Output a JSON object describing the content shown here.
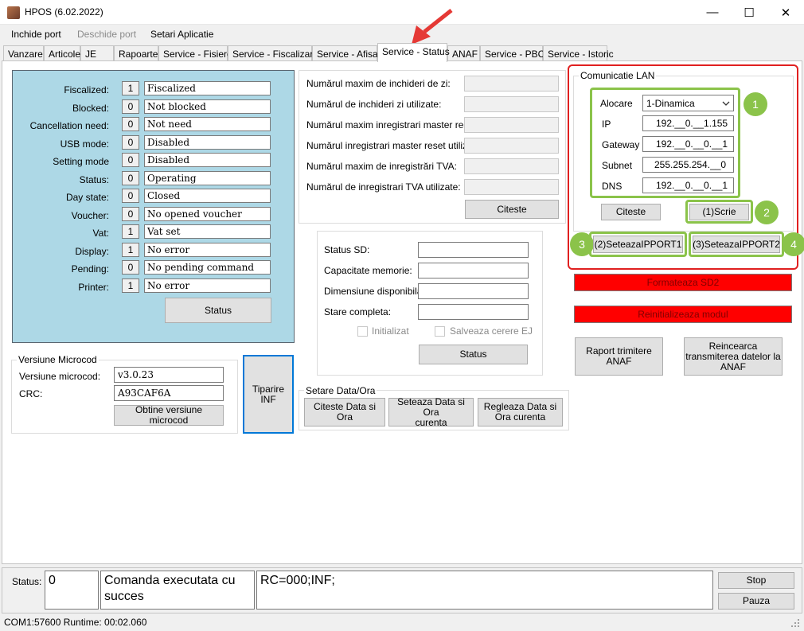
{
  "window": {
    "title": "HPOS (6.02.2022)",
    "minimize_glyph": "—",
    "maximize_glyph": "☐",
    "close_glyph": "✕"
  },
  "menu": {
    "items": [
      {
        "label": "Inchide port",
        "enabled": true
      },
      {
        "label": "Deschide port",
        "enabled": false
      },
      {
        "label": "Setari Aplicatie",
        "enabled": true
      }
    ]
  },
  "tabs": [
    {
      "label": "Vanzare"
    },
    {
      "label": "Articole"
    },
    {
      "label": "JE"
    },
    {
      "label": "Rapoarte"
    },
    {
      "label": "Service - Fisiere"
    },
    {
      "label": "Service - Fiscalizare"
    },
    {
      "label": "Service - Afisaj"
    },
    {
      "label": "Service - Status",
      "active": true
    },
    {
      "label": "ANAF"
    },
    {
      "label": "Service - PBC"
    },
    {
      "label": "Service - Istoric"
    }
  ],
  "status_panel": {
    "rows": [
      {
        "label": "Fiscalized:",
        "code": "1",
        "value": "Fiscalized"
      },
      {
        "label": "Blocked:",
        "code": "0",
        "value": "Not blocked"
      },
      {
        "label": "Cancellation need:",
        "code": "0",
        "value": "Not need"
      },
      {
        "label": "USB mode:",
        "code": "0",
        "value": "Disabled"
      },
      {
        "label": "Setting mode",
        "code": "0",
        "value": "Disabled"
      },
      {
        "label": "Status:",
        "code": "0",
        "value": "Operating"
      },
      {
        "label": "Day state:",
        "code": "0",
        "value": "Closed"
      },
      {
        "label": "Voucher:",
        "code": "0",
        "value": "No opened voucher"
      },
      {
        "label": "Vat:",
        "code": "1",
        "value": "Vat set"
      },
      {
        "label": "Display:",
        "code": "1",
        "value": "No error"
      },
      {
        "label": "Pending:",
        "code": "0",
        "value": "No pending command"
      },
      {
        "label": "Printer:",
        "code": "1",
        "value": "No error"
      }
    ],
    "status_button": "Status"
  },
  "counters": {
    "labels": [
      "Numărul maxim de inchideri de zi:",
      "Numărul de inchideri zi utilizate:",
      "Numărul maxim inregistrari master reset:",
      "Numărul inregistrari master reset utilizate:",
      "Numărul maxim de inregistrări TVA:",
      "Numărul de inregistrari TVA utilizate:"
    ],
    "citeste_button": "Citeste"
  },
  "sd": {
    "labels": [
      "Status SD:",
      "Capacitate memorie:",
      "Dimensiune disponibila",
      "Stare completa:"
    ],
    "chk_initializat": "Initializat",
    "chk_salveaza": "Salveaza cerere EJ",
    "status_button": "Status"
  },
  "microcod": {
    "group_title": "Versiune Microcod",
    "version_label": "Versiune microcod:",
    "version_value": "v3.0.23",
    "crc_label": "CRC:",
    "crc_value": "A93CAF6A",
    "obtine_button": "Obtine versiune microcod"
  },
  "tiparire_button": "Tiparire\nINF",
  "data_ora": {
    "group_title": "Setare Data/Ora",
    "citeste_button": "Citeste Data si Ora",
    "seteaza_button": "Seteaza Data si Ora\ncurenta",
    "regleaza_button": "Regleaza Data si\nOra curenta"
  },
  "lan": {
    "group_title": "Comunicatie LAN",
    "alocare_label": "Alocare",
    "alocare_value": "1-Dinamica",
    "ip_label": "IP",
    "ip_value": "192.__0.__1.155",
    "gateway_label": "Gateway",
    "gateway_value": "192.__0.__0.__1",
    "subnet_label": "Subnet",
    "subnet_value": "255.255.254.__0",
    "dns_label": "DNS",
    "dns_value": "192.__0.__0.__1",
    "citeste_button": "Citeste",
    "scrie_button": "(1)Scrie",
    "ipport1_button": "(2)SeteazaIPPORT1",
    "ipport2_button": "(3)SeteazaIPPORT2",
    "badges": [
      "1",
      "2",
      "3",
      "4"
    ],
    "highlight_color": "#8bc34a",
    "frame_color": "#e02020"
  },
  "actions": {
    "formateaza_button": "Formateaza SD2",
    "reinit_button": "Reinitializeaza modul",
    "raport_button": "Raport trimitere\nANAF",
    "reincearca_button": "Reincearca\ntransmiterea datelor la\nANAF"
  },
  "bottom": {
    "status_label": "Status:",
    "status_code": "0",
    "status_message": "Comanda executata cu succes",
    "response": "RC=000;INF;",
    "stop_button": "Stop",
    "pauza_button": "Pauza"
  },
  "statusbar": {
    "text": "COM1:57600  Runtime: 00:02.060"
  }
}
